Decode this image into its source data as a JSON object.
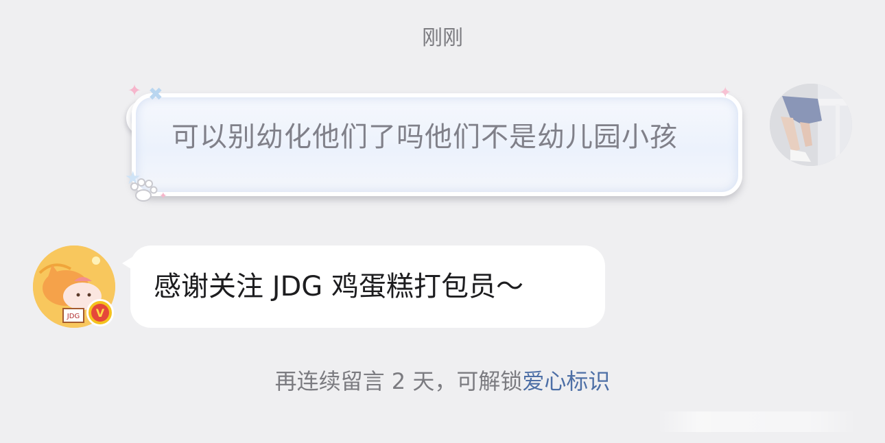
{
  "chat": {
    "timestamp": "刚刚",
    "outgoing_message": "可以别幼化他们了吗他们不是幼儿园小孩",
    "incoming_message": "感谢关注 JDG 鸡蛋糕打包员～",
    "hint_prefix": "再连续留言 2 天，可解锁",
    "hint_link": "爱心标识",
    "badge_letter": "V",
    "avatar_logo_text": "JDG"
  },
  "colors": {
    "background": "#efeff1",
    "link": "#4d6fa6",
    "muted_text": "#7b7b80",
    "badge": "#f4c21e"
  },
  "icons": {
    "outgoing_decorations": [
      "star-icon",
      "cross-icon",
      "paw-icon"
    ],
    "badge": "verified-v-icon"
  }
}
